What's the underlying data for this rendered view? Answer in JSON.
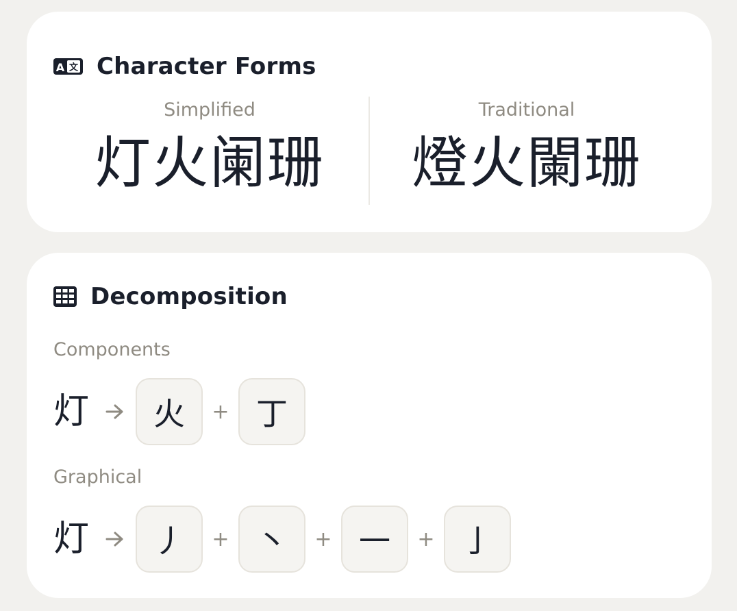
{
  "forms": {
    "title": "Character Forms",
    "icon": "translate-icon",
    "simplified_label": "Simplified",
    "simplified_text": "灯火阑珊",
    "traditional_label": "Traditional",
    "traditional_text": "燈火闌珊"
  },
  "decomposition": {
    "title": "Decomposition",
    "icon": "grid-icon",
    "components": {
      "label": "Components",
      "source": "灯",
      "parts": [
        "火",
        "丁"
      ]
    },
    "graphical": {
      "label": "Graphical",
      "source": "灯",
      "parts": [
        "丿",
        "丶",
        "一",
        "亅"
      ]
    }
  },
  "colors": {
    "background": "#f2f1ee",
    "card": "#ffffff",
    "text": "#1a1f2b",
    "muted": "#8f8b82",
    "tile": "#f5f4f1",
    "tile_border": "#e6e3dc"
  }
}
